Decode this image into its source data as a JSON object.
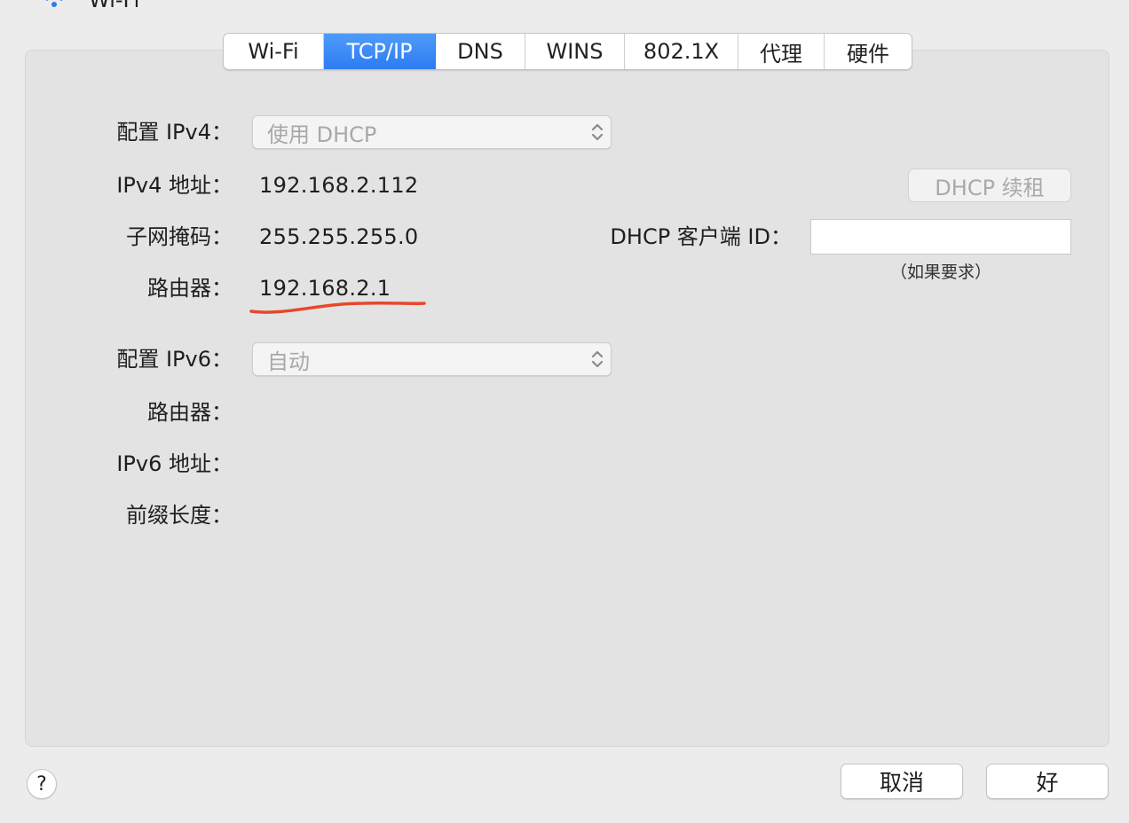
{
  "window": {
    "title": "Wi-Fi",
    "wifi_icon": "wifi-icon"
  },
  "tabs": [
    {
      "label": "Wi-Fi",
      "active": false
    },
    {
      "label": "TCP/IP",
      "active": true
    },
    {
      "label": "DNS",
      "active": false
    },
    {
      "label": "WINS",
      "active": false
    },
    {
      "label": "802.1X",
      "active": false
    },
    {
      "label": "代理",
      "active": false
    },
    {
      "label": "硬件",
      "active": false
    }
  ],
  "ipv4": {
    "configure_label": "配置 IPv4：",
    "configure_value": "使用 DHCP",
    "address_label": "IPv4 地址：",
    "address_value": "192.168.2.112",
    "subnet_label": "子网掩码：",
    "subnet_value": "255.255.255.0",
    "router_label": "路由器：",
    "router_value": "192.168.2.1",
    "renew_button": "DHCP 续租",
    "client_id_label": "DHCP 客户端 ID：",
    "client_id_value": "",
    "client_id_hint": "（如果要求）"
  },
  "ipv6": {
    "configure_label": "配置 IPv6：",
    "configure_value": "自动",
    "router_label": "路由器：",
    "address_label": "IPv6 地址：",
    "prefix_label": "前缀长度："
  },
  "footer": {
    "help_label": "?",
    "cancel_label": "取消",
    "ok_label": "好"
  },
  "colors": {
    "accent": "#2d7cf2",
    "annotation": "#e8472a",
    "disabled_text": "#a8a8a8"
  }
}
